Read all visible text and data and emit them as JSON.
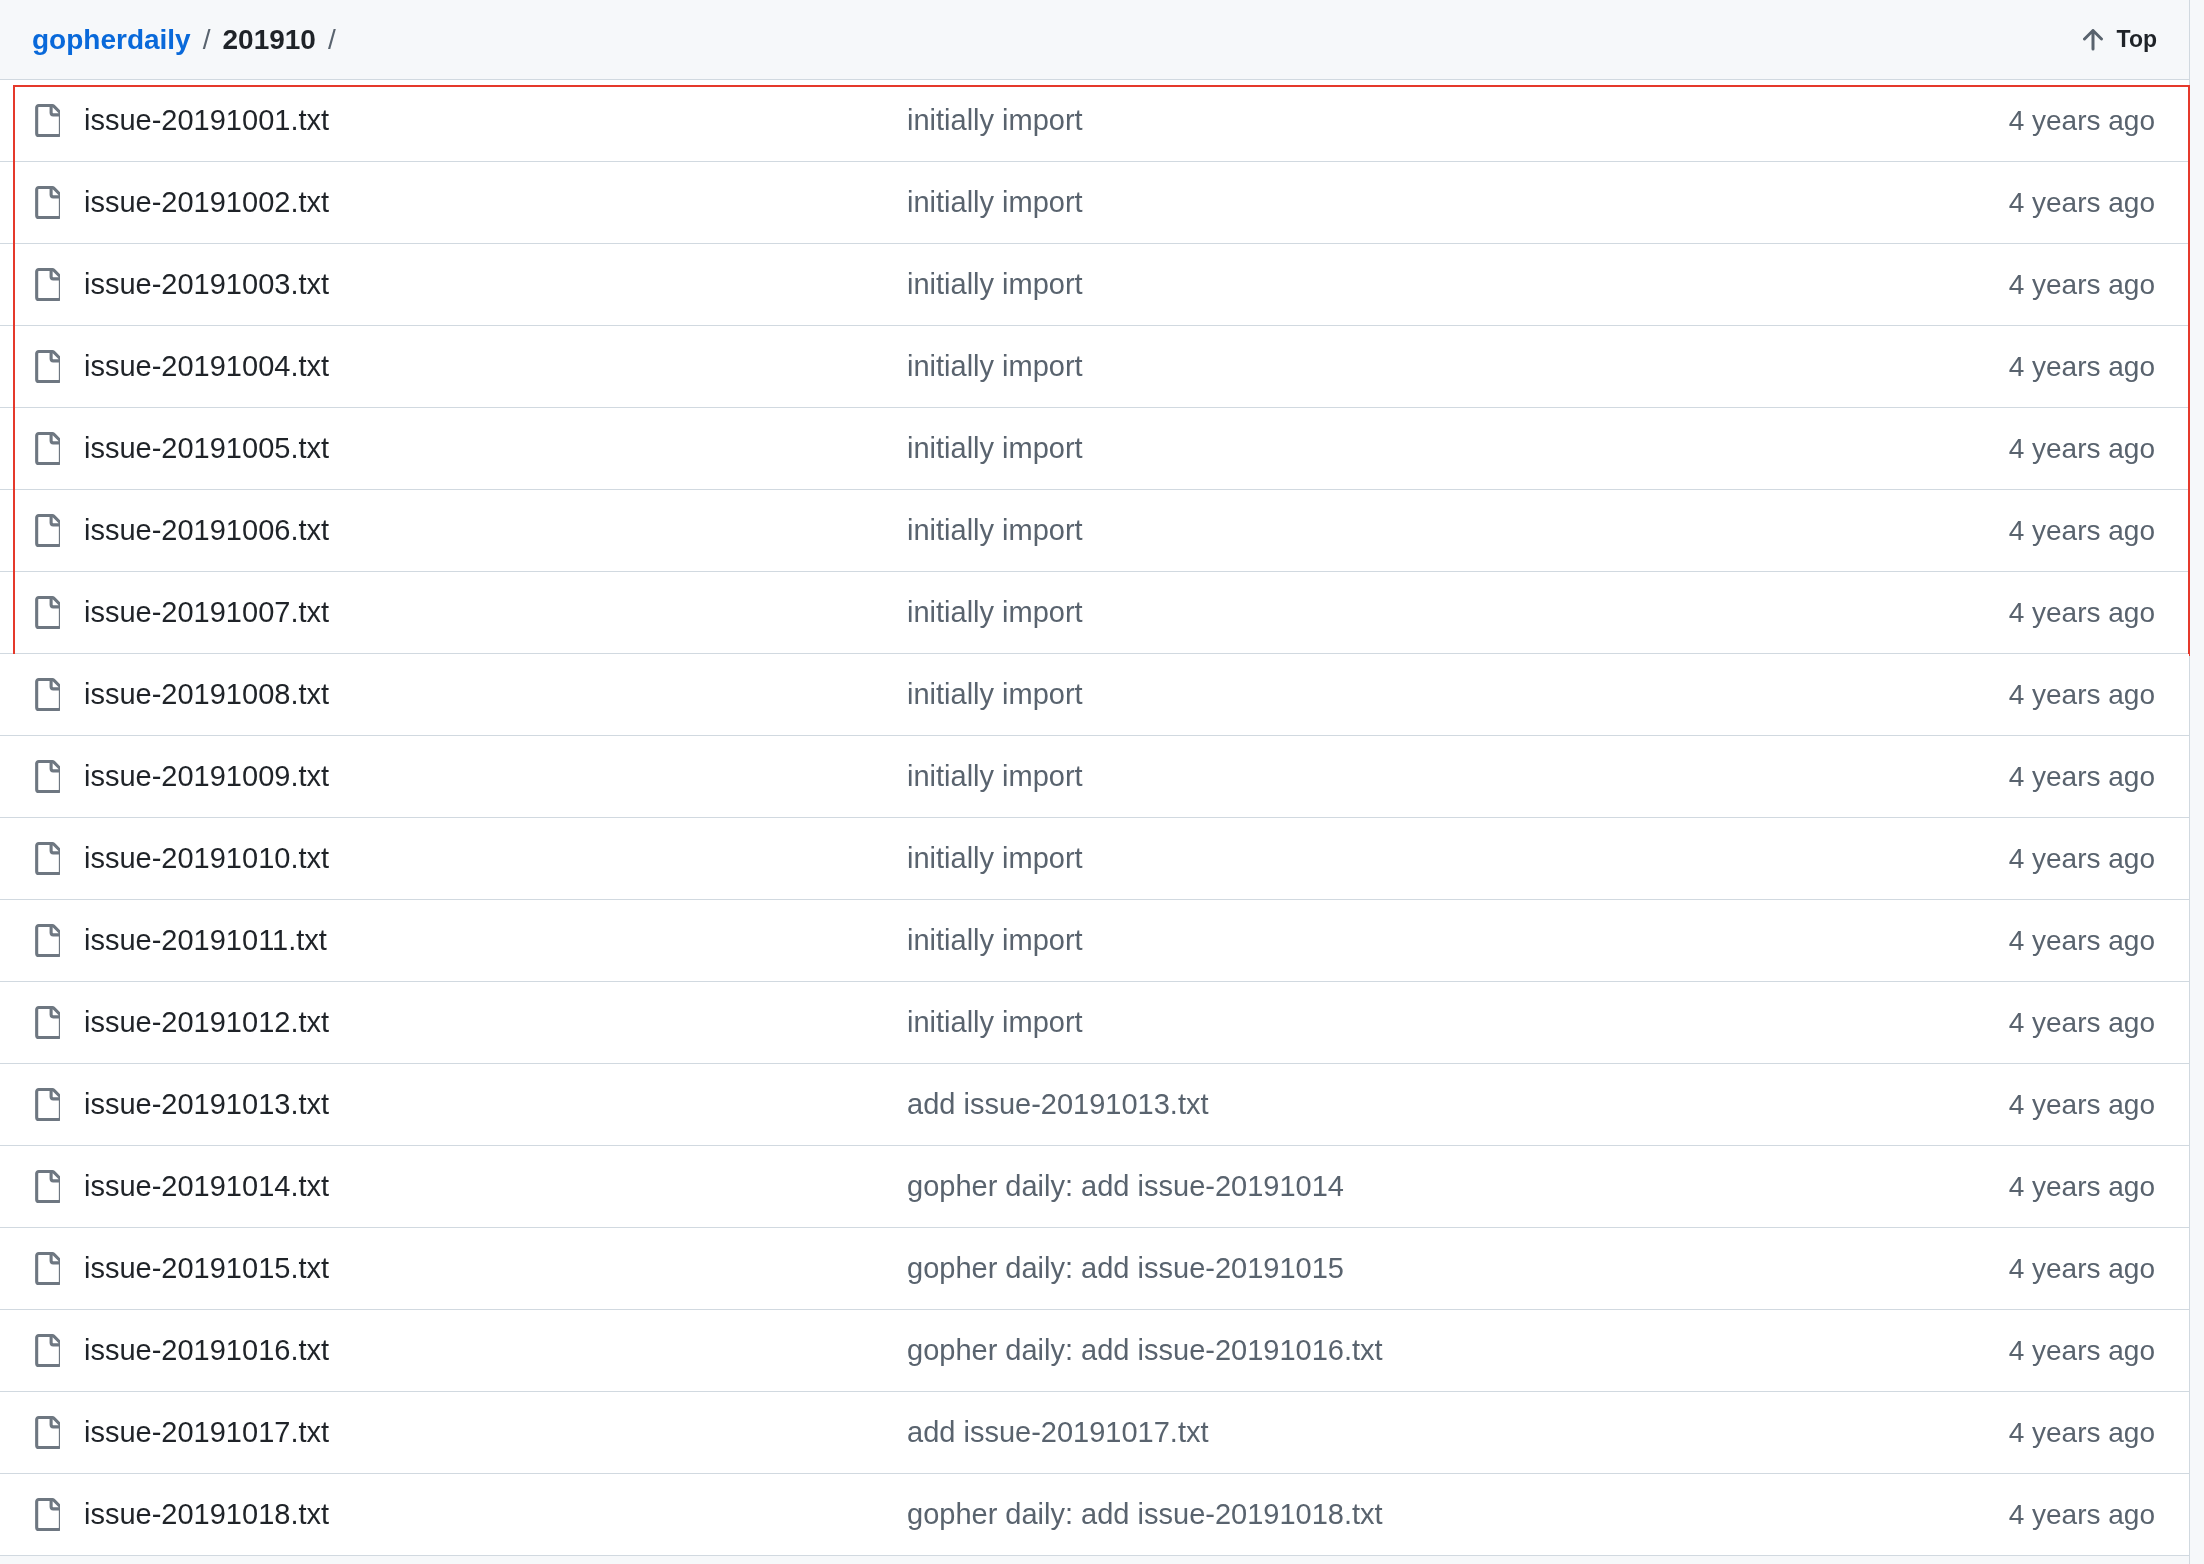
{
  "breadcrumb": [
    {
      "kind": "link",
      "label": "gopherdaily"
    },
    {
      "kind": "separator",
      "label": "/"
    },
    {
      "kind": "current",
      "label": "201910"
    },
    {
      "kind": "separator",
      "label": "/"
    }
  ],
  "top_button": {
    "label": "Top"
  },
  "row_groups": [
    {
      "highlighted": true,
      "rows": [
        {
          "name": "issue-20191001.txt",
          "message": "initially import",
          "time": "4 years ago"
        },
        {
          "name": "issue-20191002.txt",
          "message": "initially import",
          "time": "4 years ago"
        },
        {
          "name": "issue-20191003.txt",
          "message": "initially import",
          "time": "4 years ago"
        },
        {
          "name": "issue-20191004.txt",
          "message": "initially import",
          "time": "4 years ago"
        },
        {
          "name": "issue-20191005.txt",
          "message": "initially import",
          "time": "4 years ago"
        },
        {
          "name": "issue-20191006.txt",
          "message": "initially import",
          "time": "4 years ago"
        },
        {
          "name": "issue-20191007.txt",
          "message": "initially import",
          "time": "4 years ago"
        }
      ]
    },
    {
      "highlighted": false,
      "rows": [
        {
          "name": "issue-20191008.txt",
          "message": "initially import",
          "time": "4 years ago"
        },
        {
          "name": "issue-20191009.txt",
          "message": "initially import",
          "time": "4 years ago"
        },
        {
          "name": "issue-20191010.txt",
          "message": "initially import",
          "time": "4 years ago"
        },
        {
          "name": "issue-20191011.txt",
          "message": "initially import",
          "time": "4 years ago"
        },
        {
          "name": "issue-20191012.txt",
          "message": "initially import",
          "time": "4 years ago"
        },
        {
          "name": "issue-20191013.txt",
          "message": "add issue-20191013.txt",
          "time": "4 years ago"
        },
        {
          "name": "issue-20191014.txt",
          "message": "gopher daily: add issue-20191014",
          "time": "4 years ago"
        },
        {
          "name": "issue-20191015.txt",
          "message": "gopher daily: add issue-20191015",
          "time": "4 years ago"
        },
        {
          "name": "issue-20191016.txt",
          "message": "gopher daily: add issue-20191016.txt",
          "time": "4 years ago"
        },
        {
          "name": "issue-20191017.txt",
          "message": "add issue-20191017.txt",
          "time": "4 years ago"
        },
        {
          "name": "issue-20191018.txt",
          "message": "gopher daily: add issue-20191018.txt",
          "time": "4 years ago"
        }
      ]
    }
  ]
}
